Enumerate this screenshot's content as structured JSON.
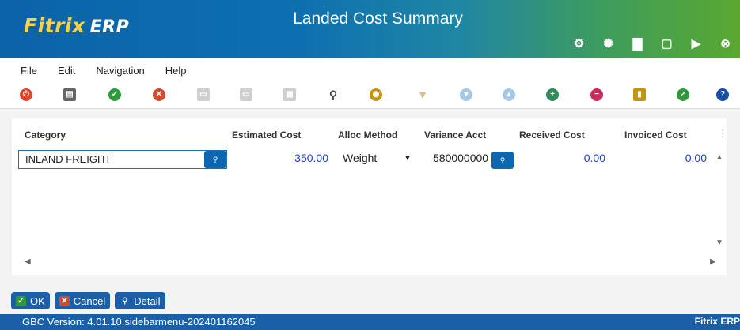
{
  "app": {
    "logo_main": "Fitrix",
    "logo_sub": "ERP",
    "window_title": "Landed Cost Summary"
  },
  "title_icons": [
    "gear-icon",
    "globe-icon",
    "document-icon",
    "page-icon",
    "play-icon",
    "close-circle-icon"
  ],
  "menu": [
    "File",
    "Edit",
    "Navigation",
    "Help"
  ],
  "toolbar": [
    {
      "name": "power-icon",
      "color": "#e0452b"
    },
    {
      "name": "copy-icon",
      "color": "#555555"
    },
    {
      "name": "check-icon",
      "color": "#2e9b3a"
    },
    {
      "name": "delete-icon",
      "color": "#d24a2a"
    },
    {
      "name": "duplicate-icon",
      "color": "#c7c7c7"
    },
    {
      "name": "paste-icon",
      "color": "#c7c7c7"
    },
    {
      "name": "grid-icon",
      "color": "#c7c7c7"
    },
    {
      "name": "search-icon",
      "color": "#444444"
    },
    {
      "name": "person-search-icon",
      "color": "#c29411"
    },
    {
      "name": "filter-icon",
      "color": "#d8c38d"
    },
    {
      "name": "arrow-down-icon",
      "color": "#a6c7e6"
    },
    {
      "name": "arrow-up-icon",
      "color": "#a6c7e6"
    },
    {
      "name": "add-row-icon",
      "color": "#2e8b5a"
    },
    {
      "name": "remove-row-icon",
      "color": "#d2285a"
    },
    {
      "name": "report-icon",
      "color": "#c29411"
    },
    {
      "name": "chart-icon",
      "color": "#2e9b3a"
    },
    {
      "name": "help-icon",
      "color": "#1a4fa8"
    }
  ],
  "grid": {
    "headers": {
      "category": "Category",
      "estimated_cost": "Estimated Cost",
      "alloc_method": "Alloc Method",
      "variance_acct": "Variance Acct",
      "received_cost": "Received Cost",
      "invoiced_cost": "Invoiced Cost"
    },
    "row": {
      "category": "INLAND FREIGHT",
      "estimated_cost": "350.00",
      "alloc_method": "Weight",
      "variance_acct": "580000000",
      "received_cost": "0.00",
      "invoiced_cost": "0.00"
    }
  },
  "buttons": {
    "ok": "OK",
    "cancel": "Cancel",
    "detail": "Detail"
  },
  "status": {
    "version": "GBC Version: 4.01.10.sidebarmenu-202401162045",
    "brand": "Fitrix ERP"
  },
  "colors": {
    "accent_blue": "#1a5fa8",
    "value_blue": "#1f3fbf"
  }
}
